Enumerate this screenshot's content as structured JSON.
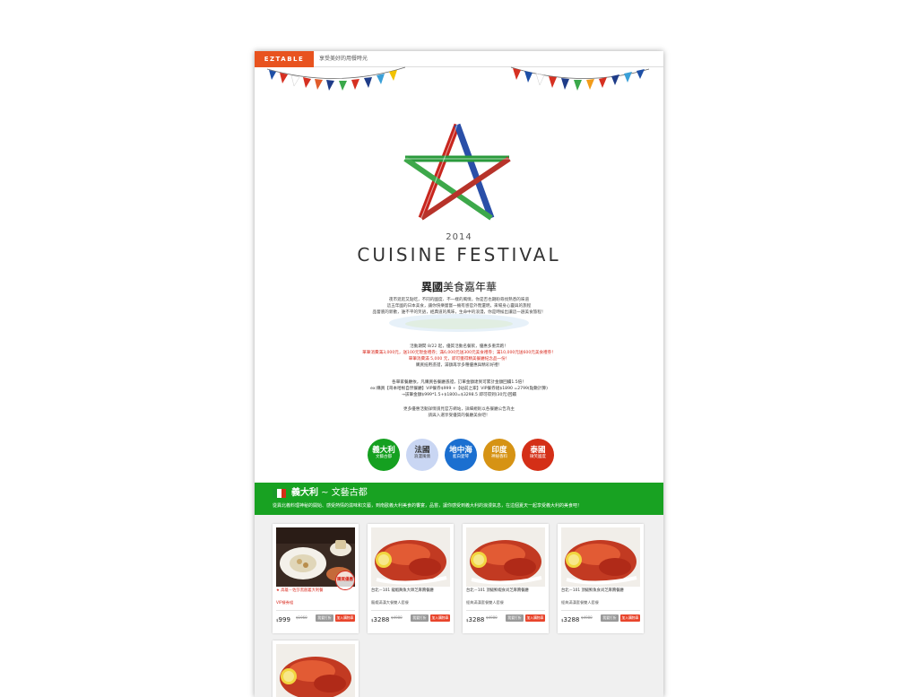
{
  "topbar": {
    "logo": "EZTABLE",
    "tagline": "享受美好的用餐時光"
  },
  "hero": {
    "year": "2014",
    "festival": "CUISINE FESTIVAL",
    "subtitle_bold": "異國",
    "subtitle_rest": "美食嘉年華",
    "intro": [
      "夜市逛逛又點吃，不同的國度、不一樣的風情，你是否也期盼尋找熟悉的味道",
      "這五年國的日本美食，讓你快樂嘗嘗一擁有感官外而還明，來場身心靈與的旅程",
      "品嘗底的新歡，誰不平的笑語，經典道的風味，生命中的浪漫，你是時候出讓這一趟美食旅程！"
    ],
    "promo": [
      "活動期間 8/22 起，優質活動名餐飲，優惠多重奔跑！",
      "單筆消費滿3,000元，送100元現金禮券；滿6,000元送300元美食禮券；滿10,000元送600元美食禮券！",
      "單筆消費滿 5,000 元，即可獲得精美餐廳紀念品一份！",
      "購買抵用憑證，滿額再享多種優惠與精彩好禮！"
    ],
    "promo2": [
      "各單家餐廳依，凡購買各餐廳憑證，訂單金額達到可累計金額回饋1.5倍！",
      "ex:購買【哥本哈根自然餐廳】VIP餐券$999 +【站前之家】VIP餐券組$1890 =2799(點數計算)",
      "→該筆金額$999*1.5+$1800=$3298.5 即可得到(30元)回饋"
    ],
    "promo3": [
      "更多優惠活動詳情請見官方網站，詳細規則以各餐廳公告為主",
      "請與入選享受優質的餐廳美食吧！"
    ]
  },
  "circles": [
    {
      "title": "義大利",
      "sub": "文藝古都",
      "color": "#15a020"
    },
    {
      "title": "法國",
      "sub": "浪漫風情",
      "color": "#c9d6f3"
    },
    {
      "title": "地中海",
      "sub": "藍白愛琴",
      "color": "#1b6fd0"
    },
    {
      "title": "印度",
      "sub": "神秘香料",
      "color": "#d69314"
    },
    {
      "title": "泰國",
      "sub": "微笑國度",
      "color": "#d42f17"
    }
  ],
  "italy": {
    "title_bold": "義大利",
    "title_rest": " ~ 文藝古都",
    "desc": "從異北義料理神秘的開始、感受熱情的滋味和文藝，到南歐義大利美食的饗宴，品嘗，讓你感受到義大利的浪漫氣息，在這個夏天一起享受義大利的美食吧！"
  },
  "cards": [
    {
      "name": "★ 高雄－佐莎黑創義大利餐",
      "name_red": true,
      "note": "VIP餐券組",
      "note_red": true,
      "price": "999",
      "orig": "$1960",
      "btn_a": "我要打折",
      "btn_b": "加入購物車",
      "stamp": "購買優惠"
    },
    {
      "name": "台北－101 龍蝦舞魚大師芝麻醬餐廳",
      "name_red": false,
      "note": "龍蝦滿漢大餐雙人套餐",
      "note_red": false,
      "price": "3288",
      "orig": "$4980",
      "btn_a": "我要打折",
      "btn_b": "加入購物車"
    },
    {
      "name": "台北－101 頂級鮮蝦食尚芝麻醬餐廳",
      "name_red": false,
      "note": "經典滿漢套餐雙人套餐",
      "note_red": false,
      "price": "3288",
      "orig": "$4980",
      "btn_a": "我要打折",
      "btn_b": "加入購物車"
    },
    {
      "name": "台北－101 頂級鮮魚食尚芝麻醬餐廳",
      "name_red": false,
      "note": "經典滿漢套餐雙人套餐",
      "note_red": false,
      "price": "3288",
      "orig": "$4980",
      "btn_a": "我要打折",
      "btn_b": "加入購物車"
    }
  ],
  "colors": {
    "brand_orange": "#e8531f",
    "italy_green": "#18a222",
    "promo_red": "#d92a1e"
  }
}
